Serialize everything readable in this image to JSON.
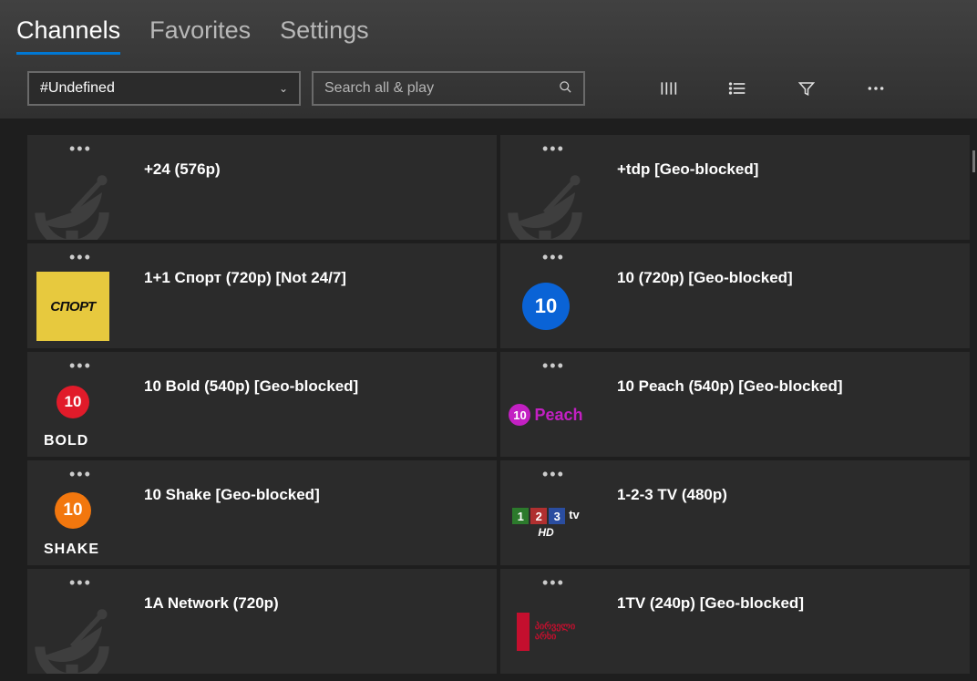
{
  "tabs": {
    "channels": "Channels",
    "favorites": "Favorites",
    "settings": "Settings"
  },
  "toolbar": {
    "combo_value": "#Undefined",
    "search_placeholder": "Search all & play"
  },
  "channels": [
    {
      "title": "+24 (576p)",
      "logo": "dish"
    },
    {
      "title": "+tdp [Geo-blocked]",
      "logo": "dish"
    },
    {
      "title": "1+1 Спорт (720p) [Not 24/7]",
      "logo": "sport"
    },
    {
      "title": "10 (720p) [Geo-blocked]",
      "logo": "ten-blue"
    },
    {
      "title": "10 Bold (540p) [Geo-blocked]",
      "logo": "ten-bold"
    },
    {
      "title": "10 Peach (540p) [Geo-blocked]",
      "logo": "ten-peach"
    },
    {
      "title": "10 Shake [Geo-blocked]",
      "logo": "ten-shake"
    },
    {
      "title": "1-2-3 TV (480p)",
      "logo": "123tv"
    },
    {
      "title": "1A Network (720p)",
      "logo": "dish"
    },
    {
      "title": "1TV (240p) [Geo-blocked]",
      "logo": "georgian"
    }
  ],
  "logo_text": {
    "sport": "СПОРТ",
    "bold": "BOLD",
    "shake": "SHAKE",
    "peach": "Peach",
    "hd": "HD",
    "tv": "tv",
    "georgian_line1": "პირველი",
    "georgian_line2": "არხი"
  }
}
